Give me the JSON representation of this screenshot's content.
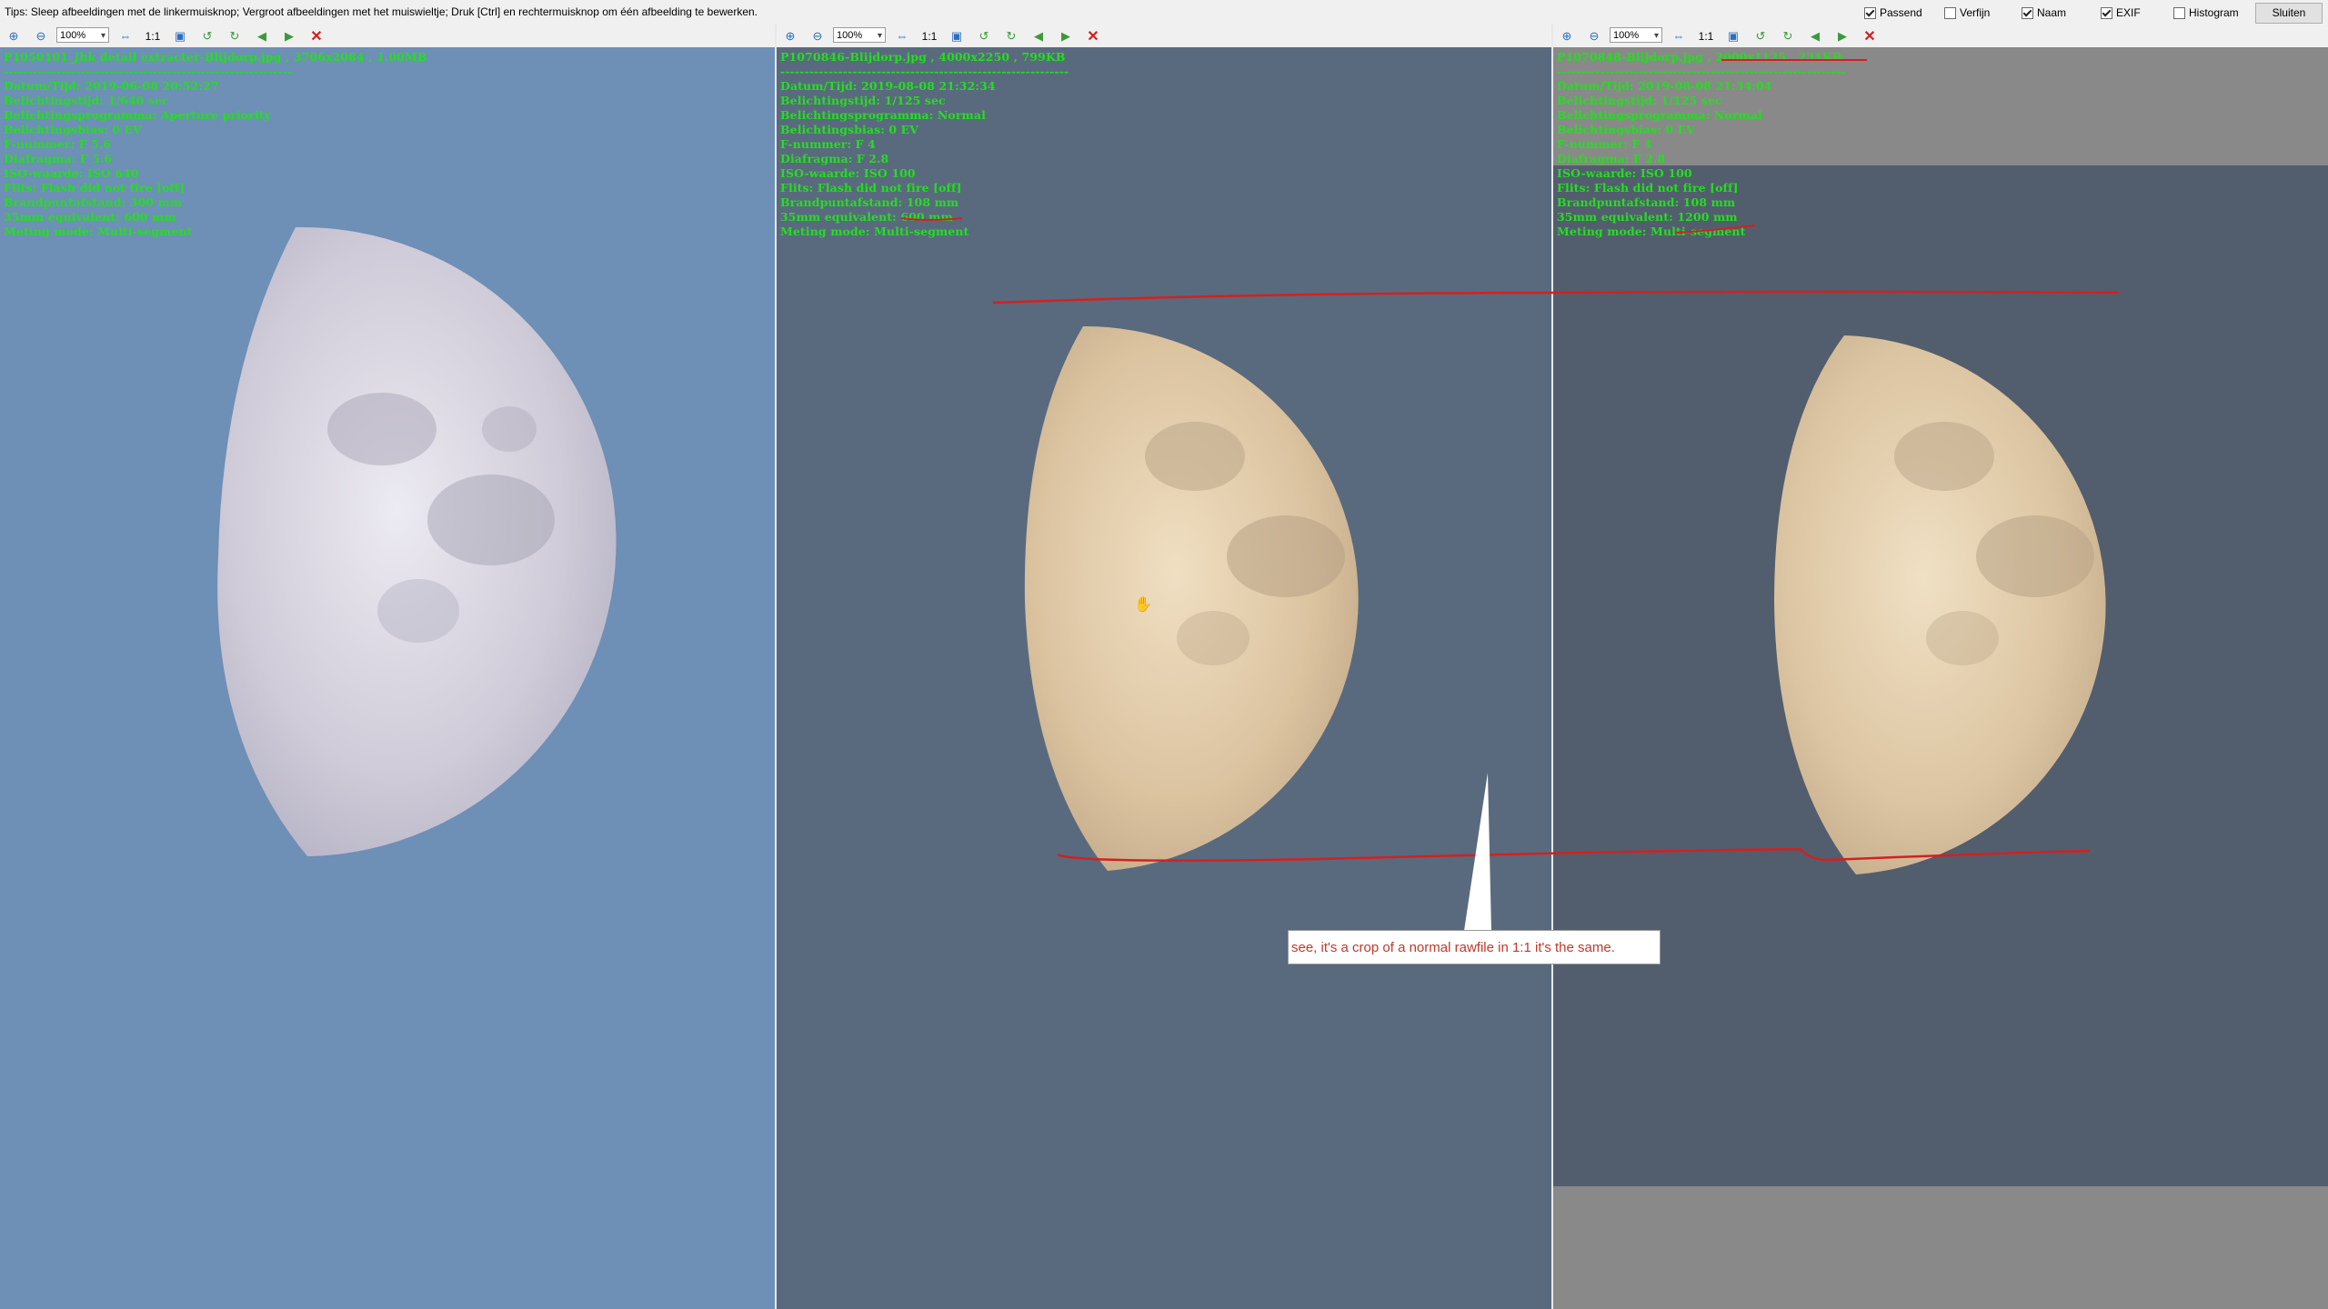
{
  "toolbar": {
    "tips": "Tips: Sleep afbeeldingen met de linkermuisknop; Vergroot afbeeldingen met het muiswieltje; Druk [Ctrl] en rechtermuisknop om één afbeelding te bewerken.",
    "options": [
      {
        "label": "Passend",
        "checked": true
      },
      {
        "label": "Verfijn",
        "checked": false
      },
      {
        "label": "Naam",
        "checked": true
      },
      {
        "label": "EXIF",
        "checked": true
      },
      {
        "label": "Histogram",
        "checked": false
      }
    ],
    "close_label": "Sluiten"
  },
  "panes": [
    {
      "zoom": "100%",
      "one_to_one": "1:1",
      "exif": [
        "P1050101_Jhk detail extracter-Blijdorp.jpg , 3706x2084 , 1.00MB",
        "------------------------------------------------------------",
        "Datum/Tijd: 2019-06-08 20:52:27",
        "Belichtingstijd: 1/640 sec",
        "Belichtingsprogramma: Aperture priority",
        "Belichtingsbias: 0 EV",
        "F-nummer: F 5.6",
        "Diafragma: F 5.6",
        "ISO-waarde: ISO 640",
        "Flits: Flash did not fire [off]",
        "Brandpuntafstand: 300 mm",
        "35mm equivalent: 600 mm",
        "Meting mode: Multi-segment"
      ],
      "bg": "#6e8fb6"
    },
    {
      "zoom": "100%",
      "one_to_one": "1:1",
      "exif": [
        "P1070846-Blijdorp.jpg , 4000x2250 , 799KB",
        "------------------------------------------------------------",
        "Datum/Tijd: 2019-08-08 21:32:34",
        "Belichtingstijd: 1/125 sec",
        "Belichtingsprogramma: Normal",
        "Belichtingsbias: 0 EV",
        "F-nummer: F 4",
        "Diafragma: F 2.8",
        "ISO-waarde: ISO 100",
        "Flits: Flash did not fire [off]",
        "Brandpuntafstand: 108 mm",
        "35mm equivalent: 600 mm",
        "Meting mode: Multi-segment"
      ],
      "bg": "#596a7e"
    },
    {
      "zoom": "100%",
      "one_to_one": "1:1",
      "exif": [
        "P1070848-Blijdorp.jpg , 2000x1125 , 231KB",
        "------------------------------------------------------------",
        "Datum/Tijd: 2019-08-08 21:34:04",
        "Belichtingstijd: 1/125 sec",
        "Belichtingsprogramma: Normal",
        "Belichtingsbias: 0 EV",
        "F-nummer: F 4",
        "Diafragma: F 2.8",
        "ISO-waarde: ISO 100",
        "Flits: Flash did not fire [off]",
        "Brandpuntafstand: 108 mm",
        "35mm equivalent: 1200 mm",
        "Meting mode: Multi-segment"
      ],
      "bg": "#525e6d"
    }
  ],
  "callout": "see, it's a crop of a normal rawfile in 1:1 it's the same."
}
